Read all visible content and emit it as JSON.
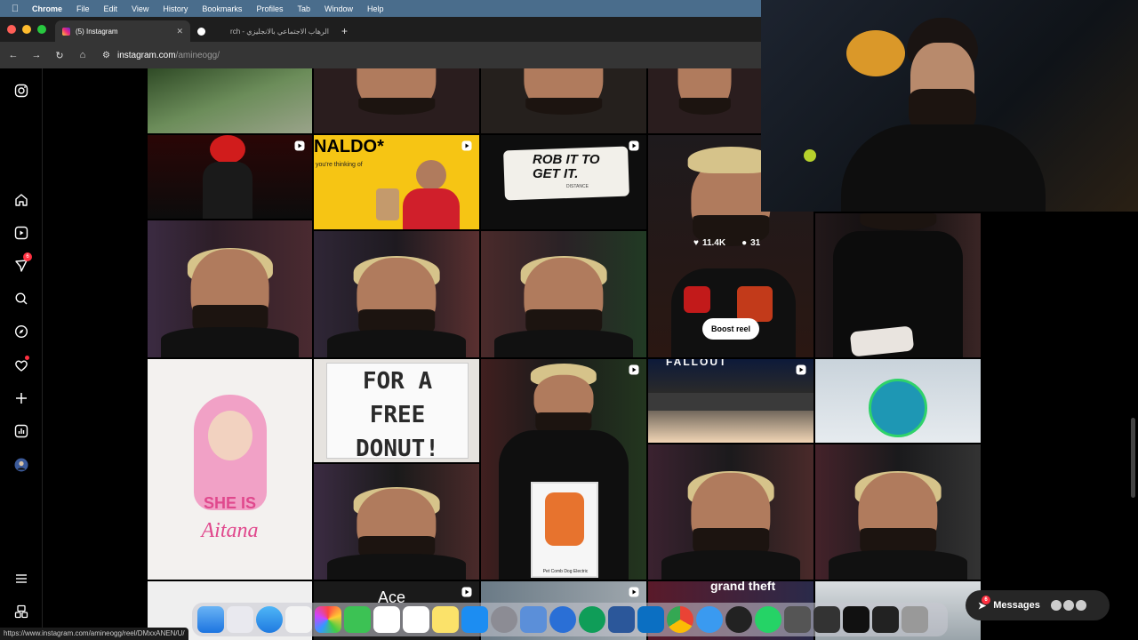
{
  "menubar": {
    "app": "Chrome",
    "items": [
      "File",
      "Edit",
      "View",
      "History",
      "Bookmarks",
      "Profiles",
      "Tab",
      "Window",
      "Help"
    ]
  },
  "tabs": [
    {
      "title": "(5) Instagram",
      "active": true
    },
    {
      "title": "الرهاب الاجتماعي بالانجليزي - rch",
      "active": false
    }
  ],
  "address": {
    "domain": "instagram.com",
    "path": "/amineogg/"
  },
  "sidebar": {
    "items": [
      "instagram-logo",
      "home",
      "reels",
      "messages",
      "search",
      "explore",
      "notifications",
      "create",
      "insights",
      "profile",
      "more",
      "threads"
    ],
    "messages_badge": "6"
  },
  "grid_text": {
    "ronaldo_head": "NALDO*",
    "ronaldo_sub": "you're thinking of",
    "rob_text": "ROB IT TO GET IT.",
    "rob_sub": "DISTANCE",
    "donut_text": "FOR A FREE DONUT!",
    "she_is": "SHE IS",
    "aitana": "Aitana",
    "pet_comb": "Pet Comb Dog Electric",
    "fallout_sign": "FALLOUT",
    "gta_logo": "grand theft",
    "ace": "Ace"
  },
  "reel_stats": {
    "likes": "11.4K",
    "comments": "31",
    "boost_label": "Boost reel"
  },
  "status_url": "https://www.instagram.com/amineogg/reel/DMxxANEN/U/",
  "messages": {
    "label": "Messages",
    "badge": "6"
  },
  "colors": {
    "accent_red": "#ff3040",
    "menubar": "#4a6d8c",
    "tab_bg": "#1e1e1e"
  }
}
